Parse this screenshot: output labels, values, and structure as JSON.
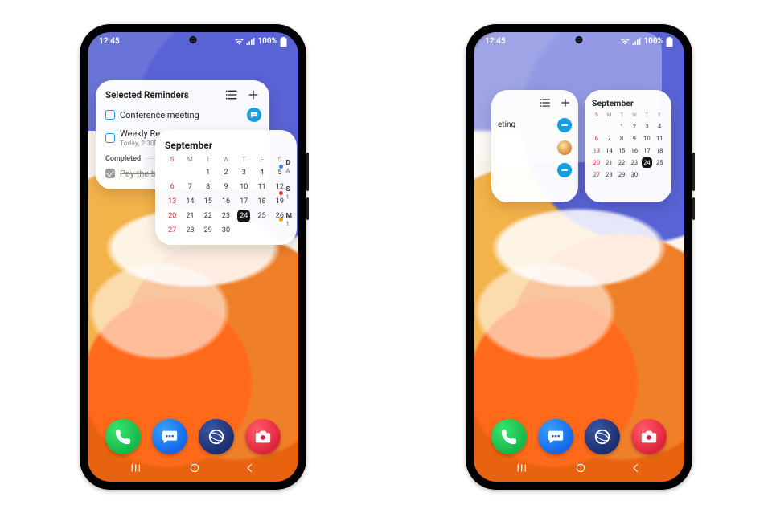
{
  "status": {
    "time": "12:45",
    "battery": "100%"
  },
  "reminders": {
    "title": "Selected Reminders",
    "items": [
      {
        "label": "Conference meeting",
        "sub": ""
      },
      {
        "label": "Weekly Re",
        "sub": "Today, 2:30P"
      }
    ],
    "completed_label": "Completed",
    "completed_item": "Pay the bi"
  },
  "phoneB_rem_fragment": "eting",
  "calendar": {
    "month": "September",
    "dow": [
      "S",
      "M",
      "T",
      "W",
      "T",
      "F",
      "S"
    ],
    "lead_blanks": 2,
    "days": 30,
    "today": 24,
    "events": [
      {
        "label": "D",
        "sub": "A",
        "color": "#3b7cff"
      },
      {
        "label": "S",
        "sub": "1",
        "color": "#e33"
      },
      {
        "label": "M",
        "sub": "1",
        "color": "#e8a300"
      }
    ]
  },
  "calendarB_dow": [
    "S",
    "M",
    "T",
    "W",
    "T",
    "F"
  ]
}
